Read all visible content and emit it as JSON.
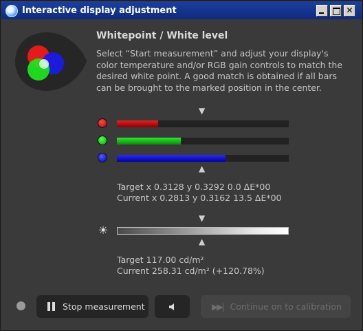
{
  "window": {
    "title": "Interactive display adjustment"
  },
  "section": {
    "heading": "Whitepoint / White level",
    "description": "Select “Start measurement” and adjust your display's color temperature and/or RGB gain controls to match the desired white point. A good match is obtained if all bars can be brought to the marked position in the center."
  },
  "rgb_bars": {
    "red": {
      "level": 0.24,
      "color": "#d41a1a"
    },
    "green": {
      "level": 0.37,
      "color": "#1fd21f"
    },
    "blue": {
      "level": 0.63,
      "color": "#1515e0"
    }
  },
  "whitepoint": {
    "target": "Target x 0.3128 y 0.3292 0.0 ΔE*00",
    "current": "Current x 0.2813 y 0.3162 13.5 ΔE*00"
  },
  "luminance_bar": {
    "level": 1.0
  },
  "luminance": {
    "target": "Target 117.00 cd/m²",
    "current": "Current 258.31 cd/m² (+120.78%)"
  },
  "buttons": {
    "stop": "Stop measurement",
    "continue": "Continue on to calibration"
  },
  "icons": {
    "app": "app-icon",
    "minimize": "minimize-icon",
    "maximize": "maximize-icon",
    "close": "close-icon",
    "pause": "pause-icon",
    "speaker": "speaker-icon",
    "fast-forward": "fast-forward-icon",
    "sun": "brightness-icon",
    "marker-down": "arrow-down-icon",
    "marker-up": "arrow-up-icon"
  }
}
